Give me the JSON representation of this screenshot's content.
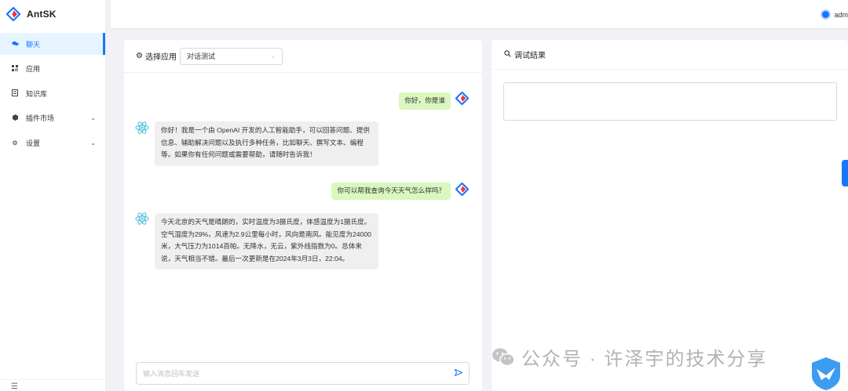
{
  "app": {
    "name": "AntSK"
  },
  "sidebar": {
    "items": [
      {
        "label": "聊天",
        "icon": "chat-icon",
        "active": true
      },
      {
        "label": "应用",
        "icon": "apps-icon"
      },
      {
        "label": "知识库",
        "icon": "book-icon"
      },
      {
        "label": "插件市场",
        "icon": "plugin-icon",
        "expandable": true
      },
      {
        "label": "设置",
        "icon": "gear-icon",
        "expandable": true
      }
    ]
  },
  "header": {
    "username": "adm"
  },
  "chat": {
    "select_app_label": "选择应用",
    "selected_app": "对话测试",
    "messages": [
      {
        "role": "user",
        "text": "你好，你是谁"
      },
      {
        "role": "ai",
        "text": "你好！我是一个由 OpenAI 开发的人工智能助手，可以回答问题、提供信息、辅助解决问题以及执行多种任务，比如聊天、撰写文本、编程等。如果你有任何问题或需要帮助，请随时告诉我！"
      },
      {
        "role": "user",
        "text": "你可以帮我查询今天天气怎么样吗？"
      },
      {
        "role": "ai",
        "text": "今天北京的天气是晴朗的，实时温度为3摄氏度，体感温度为1摄氏度。空气湿度为29%，风速为2.9公里每小时，风向是南风。能见度为24000米，大气压力为1014百帕。无降水，无云，紫外线指数为0。总体来说，天气相当不错。最后一次更新是在2024年3月3日，22:04。"
      }
    ],
    "input_placeholder": "输入消息回车发送"
  },
  "debug": {
    "title": "调试结果"
  },
  "watermark": {
    "text": "公众号 · 许泽宇的技术分享"
  },
  "colors": {
    "primary": "#1677ff",
    "user_bubble": "#d9f7be",
    "ai_bubble": "#efefef"
  }
}
